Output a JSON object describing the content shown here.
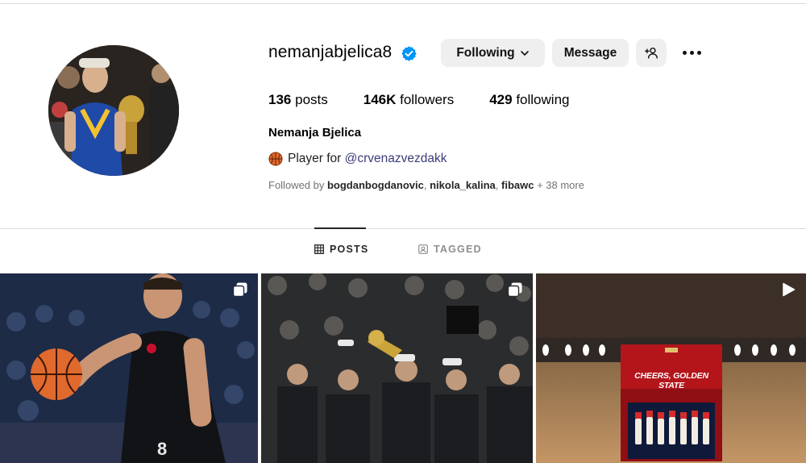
{
  "profile": {
    "username": "nemanjabjelica8",
    "verified": true,
    "full_name": "Nemanja Bjelica",
    "bio_prefix": "Player for ",
    "bio_mention": "@crvenazvezdakk",
    "bio_icon": "basketball-icon"
  },
  "actions": {
    "following_label": "Following",
    "message_label": "Message",
    "add_user_icon": "add-user-icon",
    "more_icon": "more-options-icon"
  },
  "stats": {
    "posts_count": "136",
    "posts_label": "posts",
    "followers_count": "146K",
    "followers_label": "followers",
    "following_count": "429",
    "following_label": "following"
  },
  "followed_by": {
    "prefix": "Followed by ",
    "users": [
      "bogdanbogdanovic",
      "nikola_kalina",
      "fibawc"
    ],
    "suffix": " + 38 more"
  },
  "tabs": [
    {
      "label": "POSTS",
      "icon": "grid-icon",
      "active": true
    },
    {
      "label": "TAGGED",
      "icon": "tagged-icon",
      "active": false
    }
  ],
  "posts": [
    {
      "type": "carousel",
      "badge_icon": "carousel-icon",
      "description": "player-dribbling"
    },
    {
      "type": "carousel",
      "badge_icon": "carousel-icon",
      "description": "trophy-celebration"
    },
    {
      "type": "reel",
      "badge_icon": "reel-icon",
      "overlay_text": "CHEERS, GOLDEN STATE"
    }
  ],
  "colors": {
    "verified_blue": "#0095f6",
    "button_bg": "#efefef",
    "divider": "#dbdbdb",
    "muted_text": "#737373"
  }
}
